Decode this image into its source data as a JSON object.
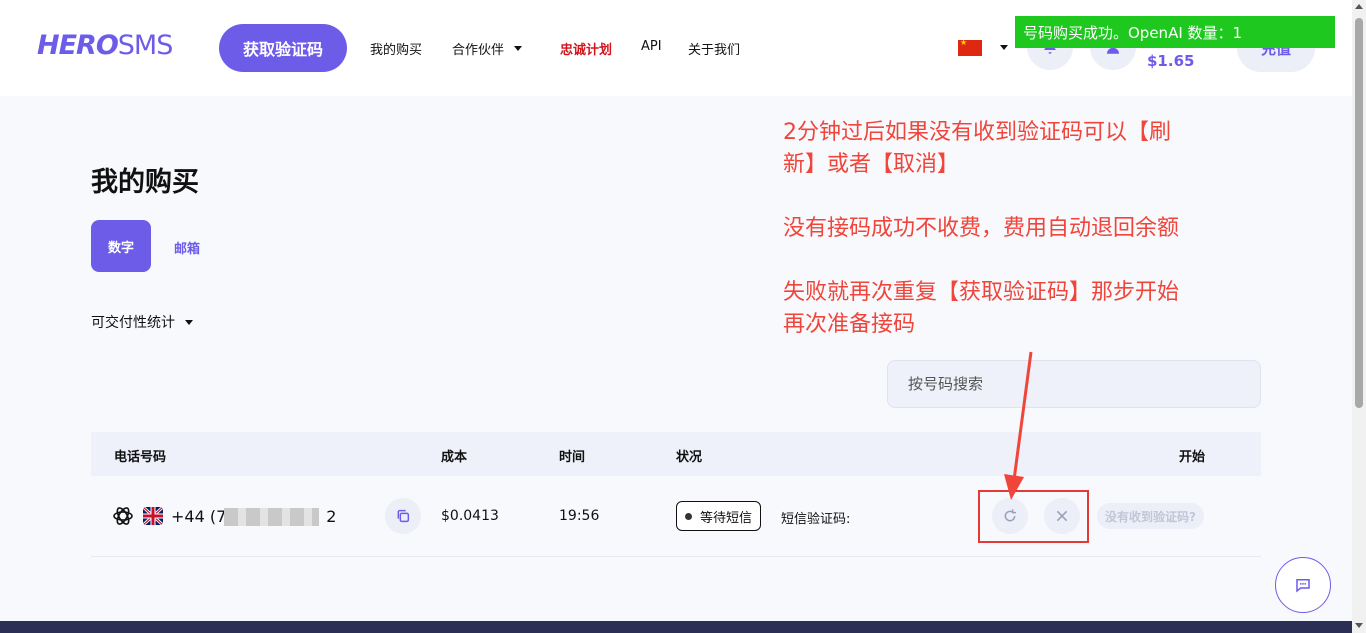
{
  "header": {
    "logo_hero": "HERO",
    "logo_sms": "SMS",
    "get_code_button": "获取验证码",
    "nav": {
      "my_purchases": "我的购买",
      "partners": "合作伙伴",
      "loyalty": "忠诚计划",
      "api": "API",
      "about": "关于我们"
    },
    "balance": "$1.65",
    "topup_button": "充值"
  },
  "toast": "号码购买成功。OpenAI 数量：1",
  "page": {
    "title": "我的购买",
    "tabs": {
      "digits": "数字",
      "email": "邮箱"
    },
    "stats_dropdown": "可交付性统计",
    "search_placeholder": "按号码搜索"
  },
  "annotations": {
    "line1": "2分钟过后如果没有收到验证码可以【刷",
    "line2": "新】或者【取消】",
    "line3": "没有接码成功不收费，费用自动退回余额",
    "line4": "失败就再次重复【获取验证码】那步开始",
    "line5": "再次准备接码",
    "color": "#f0453a"
  },
  "table": {
    "headers": {
      "phone": "电话号码",
      "cost": "成本",
      "time": "时间",
      "status": "状况",
      "start": "开始"
    },
    "rows": [
      {
        "service": "OpenAI",
        "country": "UK",
        "phone_prefix": "+44 (7",
        "phone_suffix": "2",
        "cost": "$0.0413",
        "time": "19:56",
        "status": "等待短信",
        "sms_label": "短信验证码:",
        "no_code_button": "没有收到验证码?"
      }
    ]
  },
  "colors": {
    "brand": "#6d5ce8",
    "toast": "#1ec81e",
    "loyalty": "#d4141c",
    "highlight": "#e53935"
  }
}
